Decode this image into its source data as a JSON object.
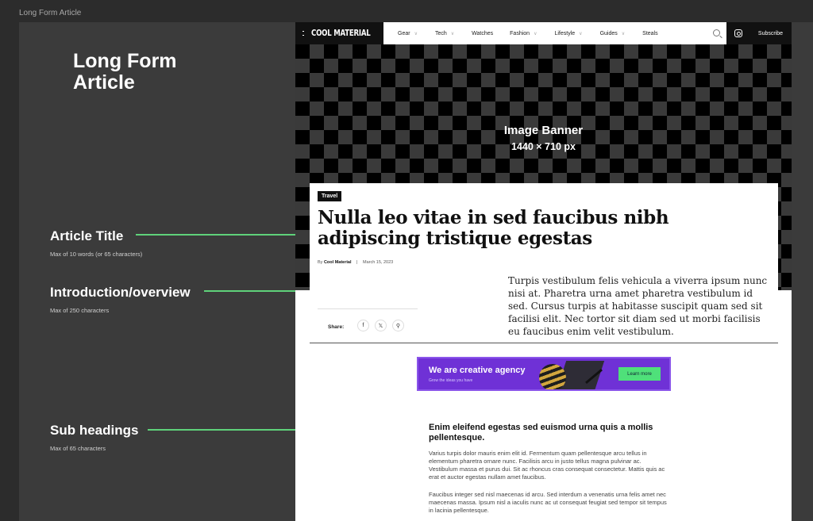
{
  "frame": {
    "label": "Long Form Article"
  },
  "left_panel": {
    "title": "Long Form Article",
    "annotations": [
      {
        "heading": "Article Title",
        "sub": "Max of 10 words (or 65 characters)"
      },
      {
        "heading": "Introduction/overview",
        "sub": "Max of 250 characters"
      },
      {
        "heading": "Sub headings",
        "sub": "Max of 65 characters"
      }
    ]
  },
  "nav": {
    "brand": "COOL MATERIAL",
    "items": [
      {
        "label": "Gear",
        "chevron": true
      },
      {
        "label": "Tech",
        "chevron": true
      },
      {
        "label": "Watches",
        "chevron": false
      },
      {
        "label": "Fashion",
        "chevron": true
      },
      {
        "label": "Lifestyle",
        "chevron": true
      },
      {
        "label": "Guides",
        "chevron": true
      },
      {
        "label": "Steals",
        "chevron": false
      }
    ],
    "subscribe": "Subscribe"
  },
  "banner": {
    "title": "Image Banner",
    "size": "1440 × 710 px"
  },
  "article": {
    "tag": "Travel",
    "title": "Nulla leo vitae in sed faucibus nibh adipiscing tristique egestas",
    "by_prefix": "By",
    "author": "Cool Material",
    "date": "March 15, 2023",
    "intro": "Turpis vestibulum felis vehicula a viverra ipsum nunc nisi at. Pharetra urna amet pharetra vestibulum id sed. Cursus turpis at habitasse suscipit quam sed sit facilisi elit. Nec tortor sit diam sed ut morbi facilisis eu faucibus enim velit vestibulum.",
    "share_label": "Share:",
    "share_icons": [
      "facebook-icon",
      "x-icon",
      "link-icon"
    ],
    "subheading": "Enim eleifend egestas sed euismod urna quis a mollis pellentesque.",
    "paragraphs": [
      "Varius turpis dolor mauris enim elit id. Fermentum quam pellentesque arcu tellus in elementum pharetra ornare nunc. Facilisis arcu in justo tellus magna pulvinar ac. Vestibulum massa et purus dui. Sit ac rhoncus cras consequat consectetur. Mattis quis ac erat et auctor egestas nullam amet faucibus.",
      "Faucibus integer sed nisl maecenas id arcu. Sed interdum a venenatis urna felis amet nec maecenas massa. Ipsum nisl a iaculis nunc ac ut consequat feugiat sed tempor sit tempus in lacinia pellentesque."
    ]
  },
  "ad": {
    "headline": "We are creative agency",
    "sub": "Grow the ideas you have",
    "button": "Learn more",
    "bg_color": "#6f31d6",
    "button_color": "#4fe07a"
  },
  "colors": {
    "accent_line": "#5fd27a",
    "nav_dark": "#111111"
  }
}
